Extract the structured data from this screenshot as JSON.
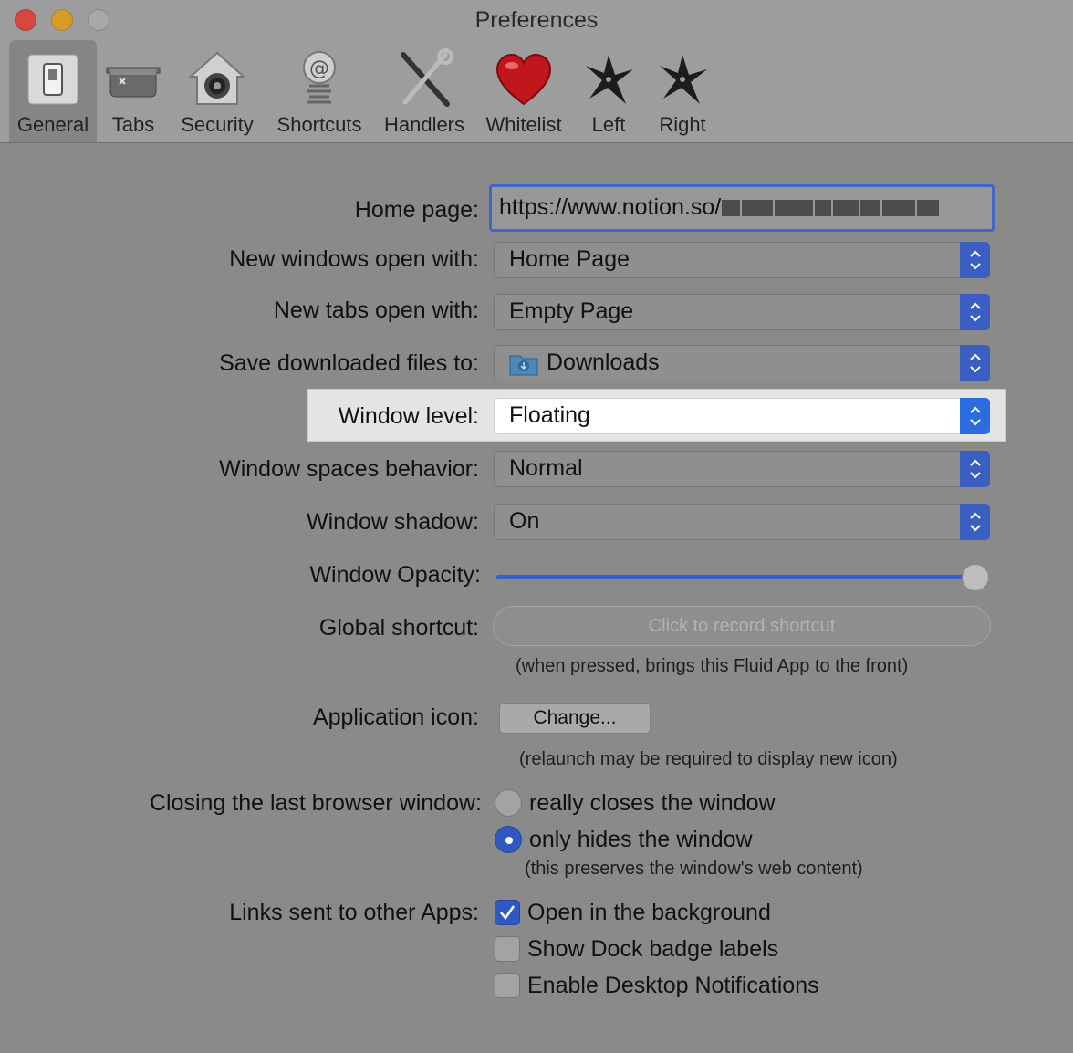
{
  "window": {
    "title": "Preferences"
  },
  "toolbar": {
    "items": [
      {
        "label": "General",
        "icon": "general-switch-icon"
      },
      {
        "label": "Tabs",
        "icon": "tabs-tray-icon"
      },
      {
        "label": "Security",
        "icon": "security-house-lock-icon"
      },
      {
        "label": "Shortcuts",
        "icon": "shortcuts-at-spring-icon"
      },
      {
        "label": "Handlers",
        "icon": "handlers-tools-icon"
      },
      {
        "label": "Whitelist",
        "icon": "whitelist-heart-icon"
      },
      {
        "label": "Left",
        "icon": "left-shuriken-icon"
      },
      {
        "label": "Right",
        "icon": "right-shuriken-icon"
      }
    ],
    "selected": "General"
  },
  "form": {
    "home_page": {
      "label": "Home page:",
      "value": "https://www.notion.so/"
    },
    "new_windows": {
      "label": "New windows open with:",
      "value": "Home Page"
    },
    "new_tabs": {
      "label": "New tabs open with:",
      "value": "Empty Page"
    },
    "save_downloads": {
      "label": "Save downloaded files to:",
      "value": "Downloads",
      "icon": "downloads-folder-icon"
    },
    "window_level": {
      "label": "Window level:",
      "value": "Floating"
    },
    "spaces_behavior": {
      "label": "Window spaces behavior:",
      "value": "Normal"
    },
    "window_shadow": {
      "label": "Window shadow:",
      "value": "On"
    },
    "opacity": {
      "label": "Window Opacity:",
      "value_fraction": 1.0
    },
    "global_shortcut": {
      "label": "Global shortcut:",
      "placeholder": "Click to record shortcut",
      "note": "(when pressed, brings this Fluid App to the front)"
    },
    "app_icon": {
      "label": "Application icon:",
      "button": "Change...",
      "note": "(relaunch may be required to display new icon)"
    },
    "closing": {
      "label": "Closing the last browser window:",
      "option1": "really closes the window",
      "option2": "only hides the window",
      "selected": "only hides the window",
      "note": "(this preserves the window's web content)"
    },
    "links": {
      "label": "Links sent to other Apps:",
      "options": [
        {
          "label": "Open in the background",
          "checked": true
        },
        {
          "label": "Show Dock badge labels",
          "checked": false
        },
        {
          "label": "Enable Desktop Notifications",
          "checked": false
        }
      ]
    }
  },
  "colors": {
    "accent": "#3a5ec2",
    "close": "#d8473f",
    "minimize": "#d89a2b",
    "background": "#8a8a8a"
  }
}
